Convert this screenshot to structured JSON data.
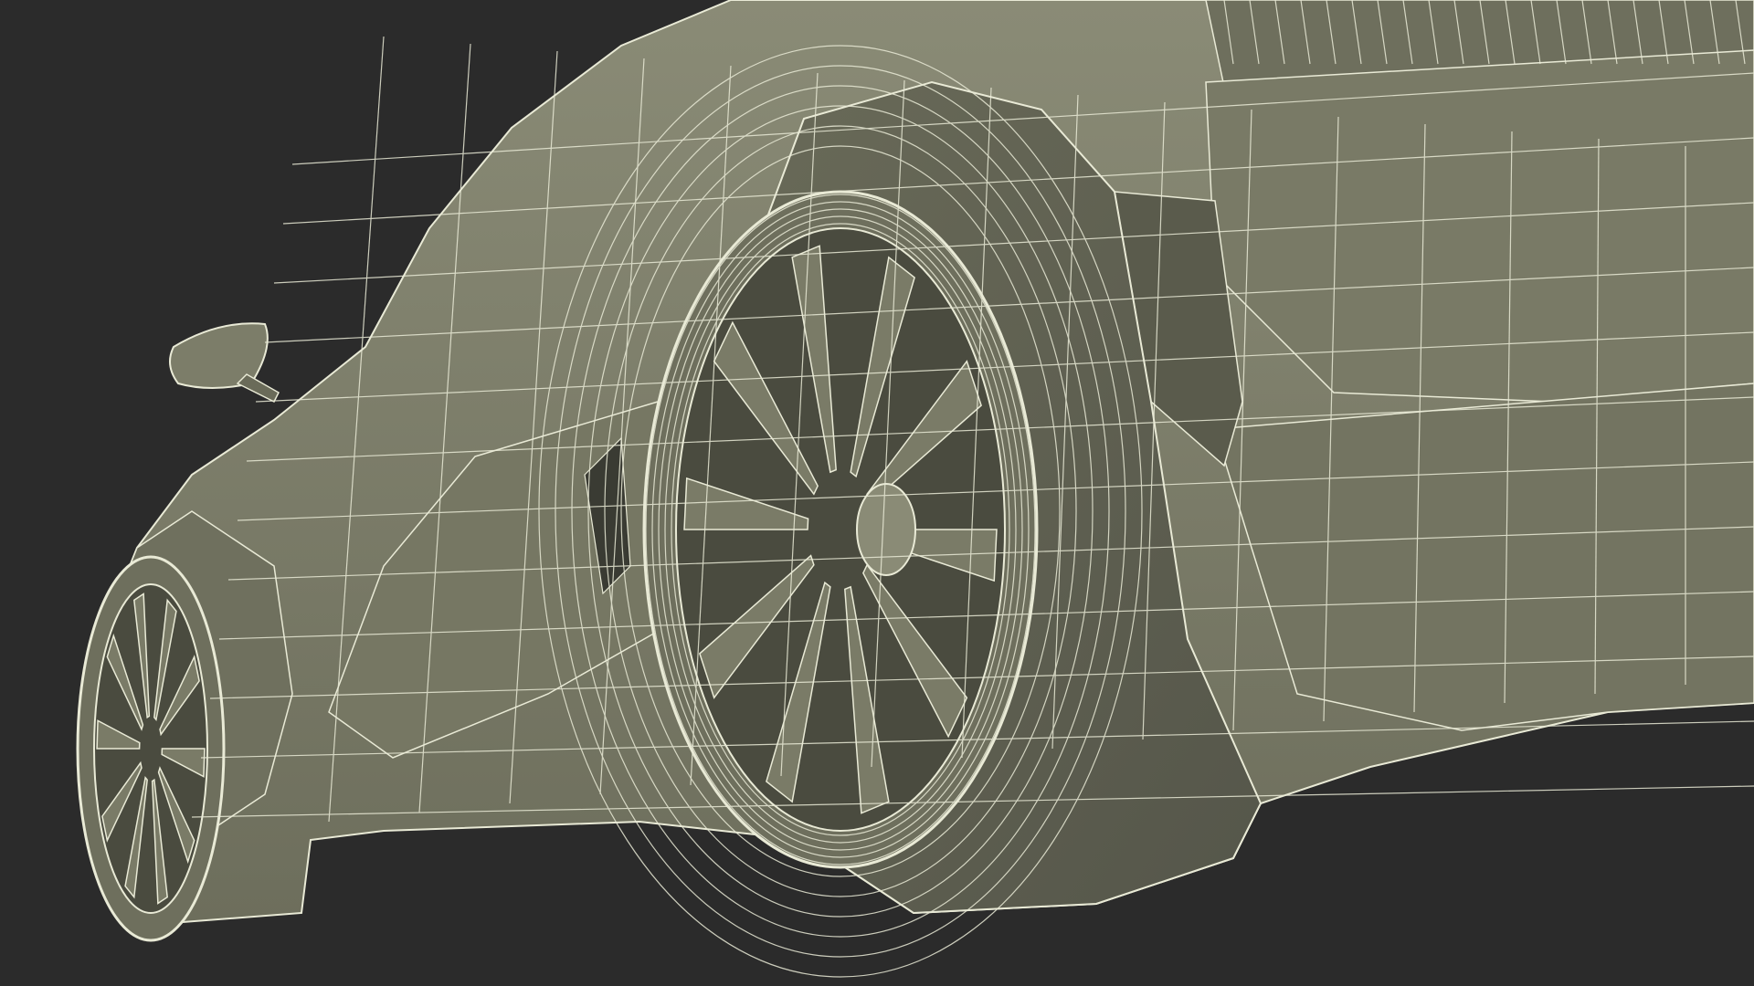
{
  "scene": {
    "subject": "wireframe-sports-car",
    "colors": {
      "background": "#2b2b2b",
      "surface": "#7c7d69",
      "surface_dark": "#5f604f",
      "surface_light": "#8a8b76",
      "wire": "#e9ead6",
      "cavity": "#3a3b33"
    }
  }
}
